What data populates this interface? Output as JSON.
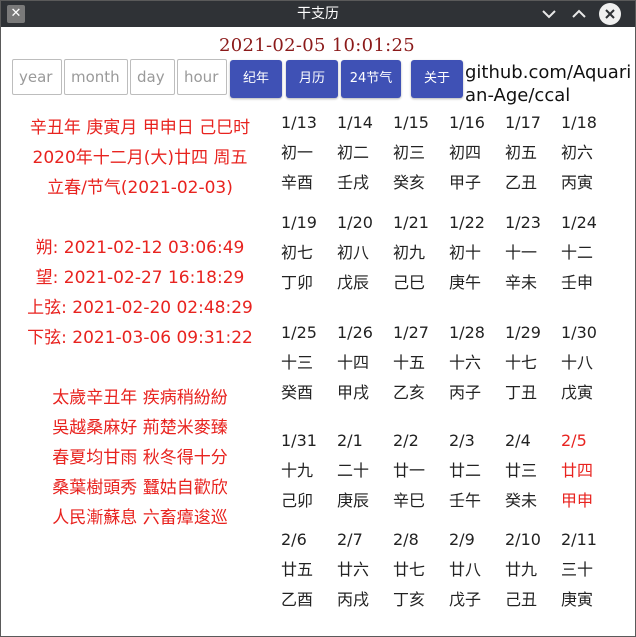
{
  "window": {
    "title": "干支历"
  },
  "clock": "2021-02-05 10:01:25",
  "inputs": {
    "year_placeholder": "year",
    "month_placeholder": "month",
    "day_placeholder": "day",
    "hour_placeholder": "hour"
  },
  "buttons": {
    "year": "纪年",
    "month": "月历",
    "jieqi": "24节气",
    "about": "关于"
  },
  "github": "github.com/Aquarian-Age/ccal",
  "info": {
    "ganzhi": "辛丑年 庚寅月 甲申日 己巳时",
    "lunar": "2020年十二月(大)廿四 周五",
    "jieqi": "立春/节气(2021-02-03)",
    "shuo": "朔: 2021-02-12 03:06:49",
    "wang": "望: 2021-02-27 16:18:29",
    "shangxian": "上弦: 2021-02-20 02:48:29",
    "xiaxian": "下弦: 2021-03-06 09:31:22",
    "poem": [
      "太歲辛丑年 疾病稍紛紛",
      "吳越桑麻好 荊楚米麥臻",
      "春夏均甘雨 秋冬得十分",
      "桑葉樹頭秀 蠶姑自歡欣",
      "人民漸蘇息 六畜瘴逡巡"
    ]
  },
  "colors": {
    "accent_red": "#e8231f",
    "button_blue": "#3f51b5",
    "titlebar": "#2f3236",
    "clock": "#8b1a1a"
  },
  "calendar": {
    "today": "2/5",
    "days": [
      {
        "date": "1/13",
        "lunar": "初一",
        "gz": "辛酉"
      },
      {
        "date": "1/14",
        "lunar": "初二",
        "gz": "壬戌"
      },
      {
        "date": "1/15",
        "lunar": "初三",
        "gz": "癸亥"
      },
      {
        "date": "1/16",
        "lunar": "初四",
        "gz": "甲子"
      },
      {
        "date": "1/17",
        "lunar": "初五",
        "gz": "乙丑"
      },
      {
        "date": "1/18",
        "lunar": "初六",
        "gz": "丙寅"
      },
      {
        "date": "1/19",
        "lunar": "初七",
        "gz": "丁卯"
      },
      {
        "date": "1/20",
        "lunar": "初八",
        "gz": "戊辰"
      },
      {
        "date": "1/21",
        "lunar": "初九",
        "gz": "己巳"
      },
      {
        "date": "1/22",
        "lunar": "初十",
        "gz": "庚午"
      },
      {
        "date": "1/23",
        "lunar": "十一",
        "gz": "辛未"
      },
      {
        "date": "1/24",
        "lunar": "十二",
        "gz": "壬申"
      },
      {
        "date": "1/25",
        "lunar": "十三",
        "gz": "癸酉"
      },
      {
        "date": "1/26",
        "lunar": "十四",
        "gz": "甲戌"
      },
      {
        "date": "1/27",
        "lunar": "十五",
        "gz": "乙亥"
      },
      {
        "date": "1/28",
        "lunar": "十六",
        "gz": "丙子"
      },
      {
        "date": "1/29",
        "lunar": "十七",
        "gz": "丁丑"
      },
      {
        "date": "1/30",
        "lunar": "十八",
        "gz": "戊寅"
      },
      {
        "date": "1/31",
        "lunar": "十九",
        "gz": "己卯"
      },
      {
        "date": "2/1",
        "lunar": "二十",
        "gz": "庚辰"
      },
      {
        "date": "2/2",
        "lunar": "廿一",
        "gz": "辛巳"
      },
      {
        "date": "2/3",
        "lunar": "廿二",
        "gz": "壬午"
      },
      {
        "date": "2/4",
        "lunar": "廿三",
        "gz": "癸未"
      },
      {
        "date": "2/5",
        "lunar": "廿四",
        "gz": "甲申"
      },
      {
        "date": "2/6",
        "lunar": "廿五",
        "gz": "乙酉"
      },
      {
        "date": "2/7",
        "lunar": "廿六",
        "gz": "丙戌"
      },
      {
        "date": "2/8",
        "lunar": "廿七",
        "gz": "丁亥"
      },
      {
        "date": "2/9",
        "lunar": "廿八",
        "gz": "戊子"
      },
      {
        "date": "2/10",
        "lunar": "廿九",
        "gz": "己丑"
      },
      {
        "date": "2/11",
        "lunar": "三十",
        "gz": "庚寅"
      }
    ]
  }
}
